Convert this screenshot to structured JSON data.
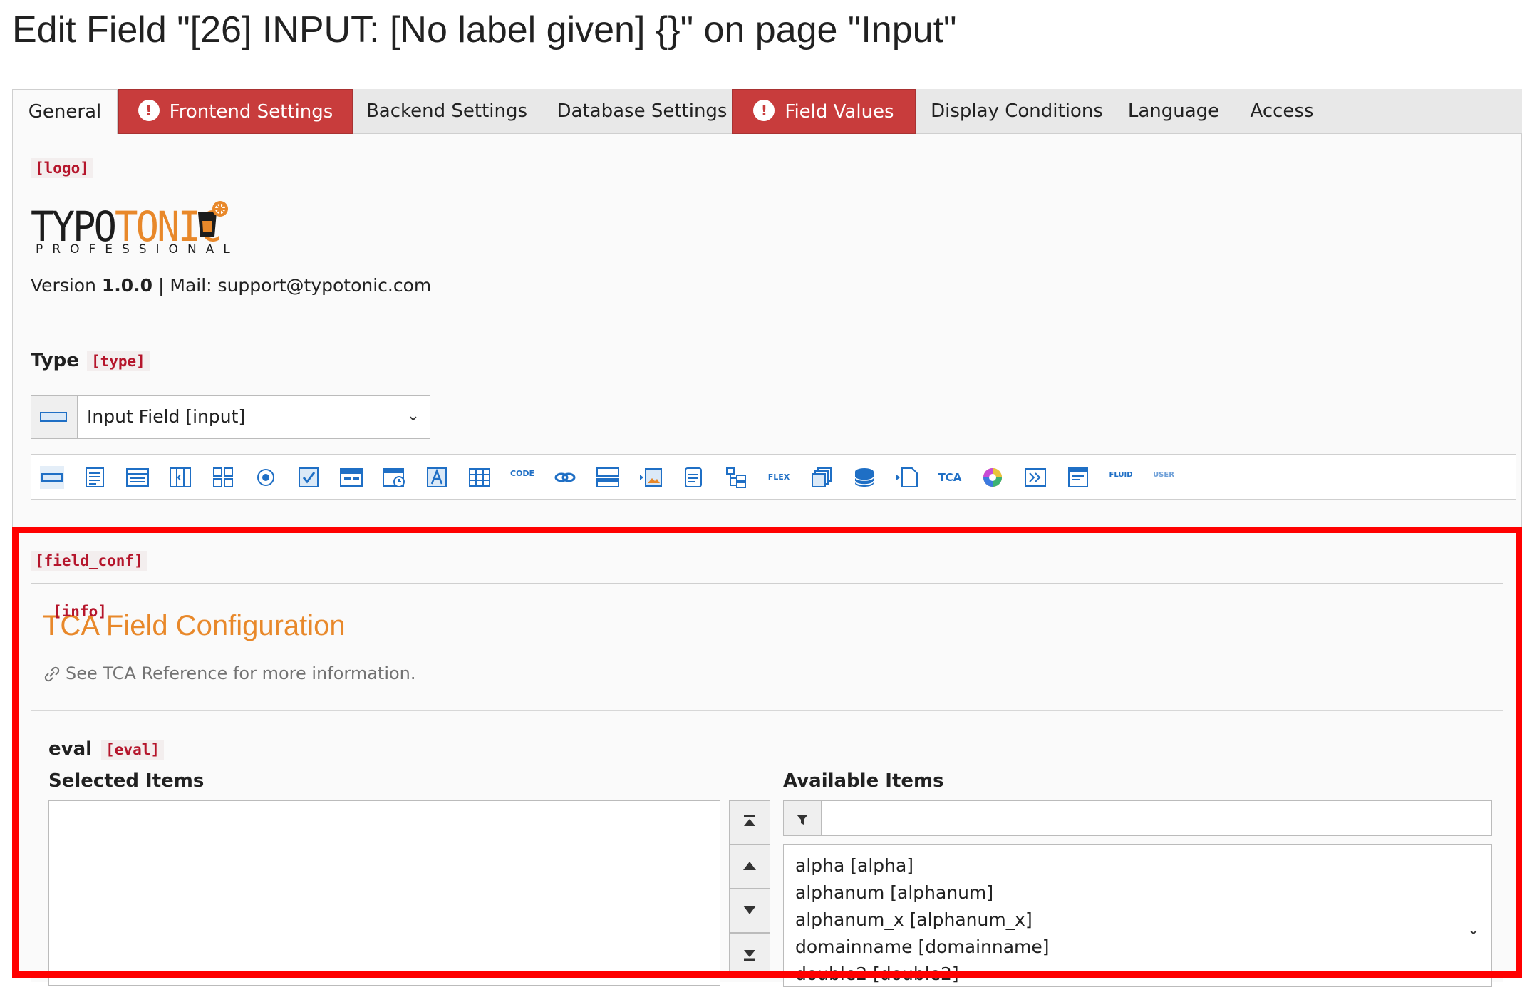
{
  "page": {
    "title": "Edit Field \"[26] INPUT: [No label given] {}\" on page \"Input\""
  },
  "tabs": [
    {
      "label": "General",
      "state": "active"
    },
    {
      "label": "Frontend Settings",
      "state": "error"
    },
    {
      "label": "Backend Settings",
      "state": "normal"
    },
    {
      "label": "Database Settings",
      "state": "normal"
    },
    {
      "label": "Field Values",
      "state": "error"
    },
    {
      "label": "Display Conditions",
      "state": "normal"
    },
    {
      "label": "Language",
      "state": "normal"
    },
    {
      "label": "Access",
      "state": "normal"
    }
  ],
  "logo_section": {
    "code": "[logo]",
    "logo_part1": "TYPO",
    "logo_part2": "TONIC",
    "logo_sub": "PROFESSIONAL",
    "version_prefix": "Version ",
    "version": "1.0.0",
    "version_suffix": " | Mail: support@typotonic.com"
  },
  "type_section": {
    "label": "Type",
    "code": "[type]",
    "selected": "Input Field [input]",
    "type_icons": [
      "input-icon",
      "text-icon",
      "rte-icon",
      "select-icon",
      "group-icon",
      "radio-icon",
      "check-icon",
      "table-icon",
      "datetime-icon",
      "text-a-icon",
      "grid-icon",
      "code-icon",
      "link-icon",
      "inline-icon",
      "image-icon",
      "file-icon",
      "tree-icon",
      "flex-icon",
      "multi-icon",
      "database-icon",
      "folder-icon",
      "tca-icon",
      "color-icon",
      "passthrough-icon",
      "form-icon",
      "fluid-icon",
      "user-icon"
    ],
    "icon_labels": {
      "code": "CODE",
      "flex": "FLEX",
      "tca": "TCA",
      "fluid": "FLUID",
      "user": "USER"
    }
  },
  "field_conf": {
    "code": "[field_conf]",
    "info_code": "[info]",
    "title": "TCA Field Configuration",
    "reference_text": "See TCA Reference for more information.",
    "eval_label": "eval",
    "eval_code": "[eval]",
    "selected_items_label": "Selected Items",
    "available_items_label": "Available Items",
    "filter_value": "",
    "available_items": [
      "alpha [alpha]",
      "alphanum [alphanum]",
      "alphanum_x [alphanum_x]",
      "domainname [domainname]",
      "double2 [double2]"
    ]
  },
  "colors": {
    "accent_orange": "#e8882a",
    "error_tab": "#c83c3c",
    "highlight": "#ff0000",
    "code_red": "#b5152b",
    "icon_blue": "#1f6fc5"
  }
}
